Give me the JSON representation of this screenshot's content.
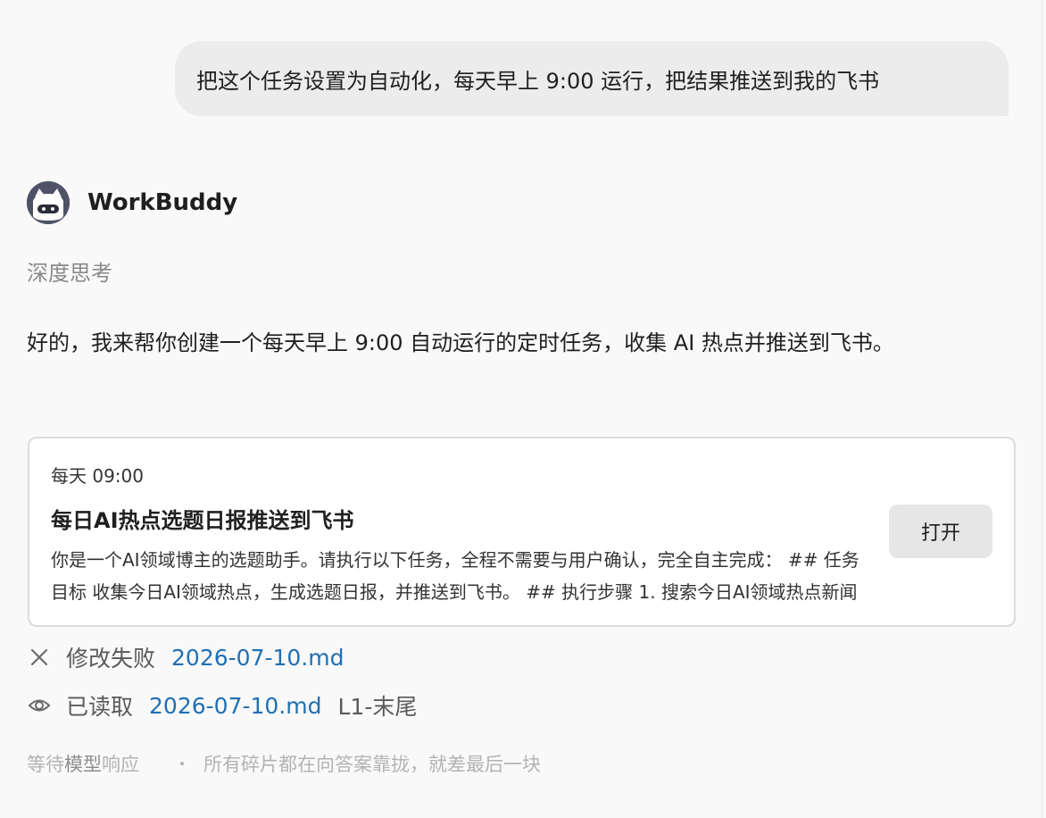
{
  "user_message": {
    "text": "把这个任务设置为自动化，每天早上 9:00 运行，把结果推送到我的飞书"
  },
  "assistant": {
    "name": "WorkBuddy",
    "thinking_label": "深度思考",
    "reply_text": "好的，我来帮你创建一个每天早上 9:00 自动运行的定时任务，收集 AI 热点并推送到飞书。"
  },
  "task_card": {
    "schedule": "每天 09:00",
    "title": "每日AI热点选题日报推送到飞书",
    "description": "你是一个AI领域博主的选题助手。请执行以下任务，全程不需要与用户确认，完全自主完成： ## 任务目标 收集今日AI领域热点，生成选题日报，并推送到飞书。 ## 执行步骤 1. 搜索今日AI领域热点新闻",
    "open_button_label": "打开"
  },
  "operations": [
    {
      "icon": "close-icon",
      "label": "修改失败",
      "file": "2026-07-10.md",
      "extra": ""
    },
    {
      "icon": "eye-icon",
      "label": "已读取",
      "file": "2026-07-10.md",
      "extra": "L1-末尾"
    }
  ],
  "status": {
    "waiting_text": "等待模型响应",
    "progress_text": "所有碎片都在向答案靠拢，就差最后一块"
  },
  "colors": {
    "background": "#f9f9f9",
    "user_bubble": "#ececec",
    "link": "#1f6fb5",
    "avatar": "#4f5166",
    "muted_text": "#8a8a8a"
  }
}
